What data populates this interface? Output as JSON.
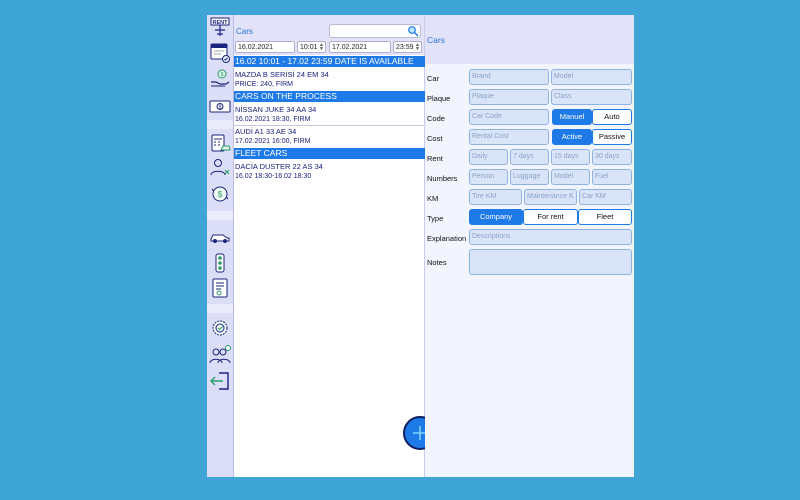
{
  "list": {
    "title": "Cars",
    "search_placeholder": "",
    "start_date": "16.02.2021",
    "start_time": "10:01",
    "end_date": "17.02.2021",
    "end_time": "23:59",
    "available_banner": "16.02 10:01 - 17.02 23:59 DATE IS AVAILABLE",
    "available": [
      {
        "name": "MAZDA B SERİSİ 24 EM 34",
        "detail": "PRICE: 240, FIRM"
      }
    ],
    "process_header": "CARS ON THE PROCESS",
    "process": [
      {
        "name": "NİSSAN JUKE 34 AA 34",
        "detail": "16.02.2021 18:30, FIRM"
      },
      {
        "name": "AUDİ A1 33 AE 34",
        "detail": "17.02.2021 16:00, FIRM"
      }
    ],
    "fleet_header": "FLEET CARS",
    "fleet": [
      {
        "name": "DACİA DUSTER 22 AS 34",
        "detail": "16.02 18:30-16.02 18:30"
      }
    ]
  },
  "form": {
    "title": "Cars",
    "labels": {
      "car": "Car",
      "plaque": "Plaque",
      "code": "Code",
      "cost": "Cost",
      "rent": "Rent",
      "numbers": "Numbers",
      "km": "KM",
      "type": "Type",
      "explanation": "Explanation",
      "notes": "Notes"
    },
    "placeholders": {
      "brand": "Brand",
      "model": "Model",
      "plaque": "Plaque",
      "class": "Class",
      "car_code": "Car Code",
      "rental_cost": "Rental Cost",
      "daily": "Daily",
      "days7": "7 days",
      "days15": "15 days",
      "days30": "30 days",
      "person": "Person",
      "luggage": "Luggage",
      "model_num": "Model",
      "fuel": "Fuel",
      "tire_km": "Tire KM",
      "maintenance_km": "Maintenance K",
      "car_km": "Car KM",
      "descriptions": "Descriptions",
      "notes": ""
    },
    "transmission": {
      "manual": "Manuel",
      "auto": "Auto",
      "selected": "Manuel"
    },
    "status": {
      "active": "Active",
      "passive": "Passive",
      "selected": "Active"
    },
    "type": {
      "company": "Company",
      "for_rent": "For rent",
      "fleet": "Fleet",
      "selected": "Company"
    }
  },
  "sidebar": {
    "rent_sign": "RENT"
  },
  "colors": {
    "accent": "#1e7ae6",
    "background": "#3fa5d6",
    "header": "#e2e2f9",
    "field": "#d9e4f8"
  }
}
